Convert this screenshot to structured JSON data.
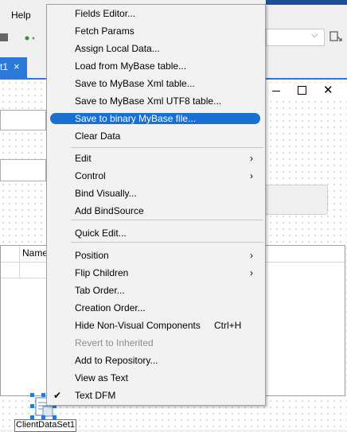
{
  "menubar": {
    "help_label": "Help"
  },
  "tab": {
    "label": "t1",
    "close": "×"
  },
  "grid": {
    "name_header": "Name"
  },
  "window_controls": {
    "close": "✕"
  },
  "component": {
    "label": "ClientDataSet1"
  },
  "context_menu": {
    "items": [
      {
        "label": "Fields Editor...",
        "kind": "item"
      },
      {
        "label": "Fetch Params",
        "kind": "item"
      },
      {
        "label": "Assign Local Data...",
        "kind": "item"
      },
      {
        "label": "Load from MyBase table...",
        "kind": "item"
      },
      {
        "label": "Save to MyBase Xml table...",
        "kind": "item"
      },
      {
        "label": "Save to MyBase Xml UTF8 table...",
        "kind": "item"
      },
      {
        "label": "Save to binary MyBase file...",
        "kind": "item",
        "highlighted": true
      },
      {
        "label": "Clear Data",
        "kind": "item"
      },
      {
        "label": "Edit",
        "kind": "submenu"
      },
      {
        "label": "Control",
        "kind": "submenu"
      },
      {
        "label": "Bind Visually...",
        "kind": "item"
      },
      {
        "label": "Add BindSource",
        "kind": "item"
      },
      {
        "label": "Quick Edit...",
        "kind": "item"
      },
      {
        "label": "Position",
        "kind": "submenu"
      },
      {
        "label": "Flip Children",
        "kind": "submenu"
      },
      {
        "label": "Tab Order...",
        "kind": "item"
      },
      {
        "label": "Creation Order...",
        "kind": "item"
      },
      {
        "label": "Hide Non-Visual Components",
        "kind": "item",
        "shortcut": "Ctrl+H"
      },
      {
        "label": "Revert to Inherited",
        "kind": "item",
        "disabled": true
      },
      {
        "label": "Add to Repository...",
        "kind": "item"
      },
      {
        "label": "View as Text",
        "kind": "item"
      },
      {
        "label": "Text DFM",
        "kind": "item",
        "checked": true
      }
    ],
    "submenu_arrow": "›",
    "check_mark": "✔"
  },
  "colors": {
    "accent": "#1a6fd3",
    "tab_active": "#2b79d6"
  }
}
